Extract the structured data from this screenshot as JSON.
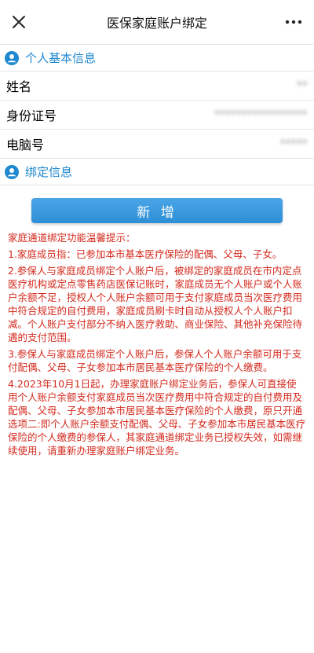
{
  "header": {
    "title": "医保家庭账户绑定",
    "close_icon": "close-icon",
    "more_icon": "more-options-icon"
  },
  "personal_section": {
    "title": "个人基本信息",
    "icon": "user-icon",
    "color": "#1e88d0"
  },
  "fields": [
    {
      "label": "姓名",
      "value": "**"
    },
    {
      "label": "身份证号",
      "value": "*****************"
    },
    {
      "label": "电脑号",
      "value": "*****"
    }
  ],
  "binding_section": {
    "title": "绑定信息",
    "icon": "user-icon"
  },
  "add_button": {
    "label": "新 增",
    "color": "#2d8fd6"
  },
  "tips": {
    "color": "#d42a1e",
    "title": "家庭通道绑定功能温馨提示：",
    "items": [
      "1.家庭成员指：已参加本市基本医疗保险的配偶、父母、子女。",
      "2.参保人与家庭成员绑定个人账户后，被绑定的家庭成员在市内定点医疗机构或定点零售药店医保记账时，家庭成员无个人账户或个人账户余额不足，授权人个人账户余额可用于支付家庭成员当次医疗费用中符合规定的自付费用，家庭成员刷卡时自动从授权人个人账户扣减。个人账户支付部分不纳入医疗救助、商业保险、其他补充保险待遇的支付范围。",
      "3.参保人与家庭成员绑定个人账户后，参保人个人账户余额可用于支付配偶、父母、子女参加本市居民基本医疗保险的个人缴费。",
      "4.2023年10月1日起，办理家庭账户绑定业务后，参保人可直接使用个人账户余额支付家庭成员当次医疗费用中符合规定的自付费用及配偶、父母、子女参加本市居民基本医疗保险的个人缴费，原只开通选项二:即个人账户余额支付配偶、父母、子女参加本市居民基本医疗保险的个人缴费的参保人，其家庭通道绑定业务已授权失效，如需继续使用，请重新办理家庭账户绑定业务。"
    ]
  }
}
